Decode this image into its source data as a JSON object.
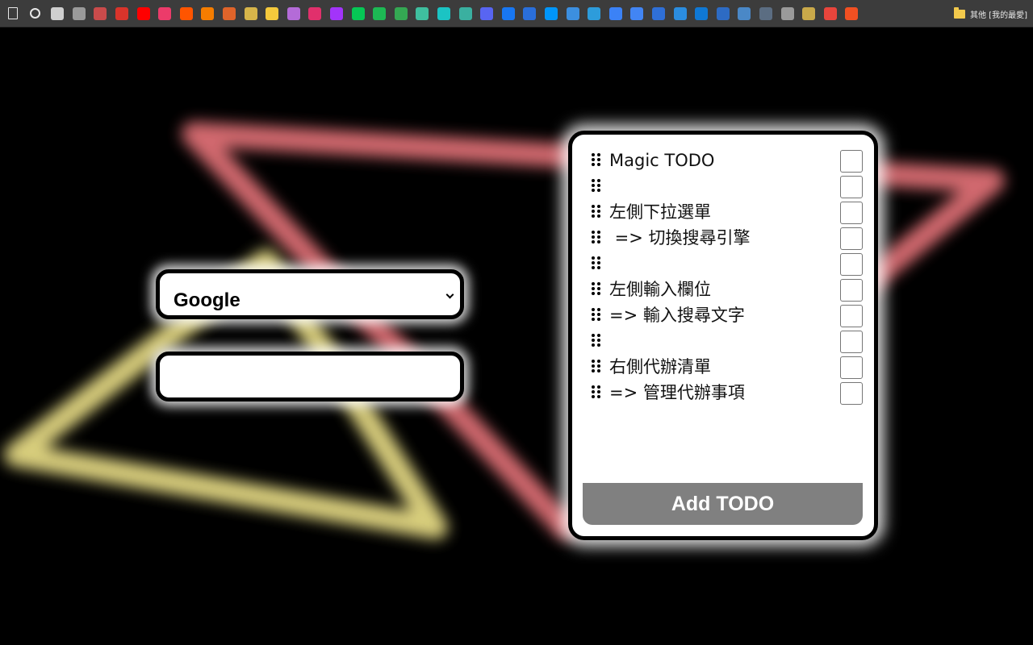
{
  "bookmarks_bar": {
    "icons": [
      {
        "name": "page-icon",
        "kind": "doc",
        "color": "#e8e8e8"
      },
      {
        "name": "search-page-icon",
        "kind": "search",
        "color": "#e8e8e8"
      },
      {
        "name": "bookmark-icon-3",
        "color": "#cfcfcf"
      },
      {
        "name": "bookmark-icon-4",
        "color": "#9a9a9a"
      },
      {
        "name": "bookmark-icon-5",
        "color": "#c94b4b"
      },
      {
        "name": "bookmark-icon-6",
        "color": "#d9342b"
      },
      {
        "name": "youtube-icon",
        "color": "#ff0000"
      },
      {
        "name": "bookmark-icon-8",
        "color": "#ec3b6a"
      },
      {
        "name": "soundcloud-icon",
        "color": "#ff5500"
      },
      {
        "name": "blogger-icon",
        "color": "#f57d00"
      },
      {
        "name": "bookmark-icon-11",
        "color": "#e0642a"
      },
      {
        "name": "bookmark-icon-12",
        "color": "#d7b54a"
      },
      {
        "name": "bookmark-icon-13",
        "color": "#f5c93c"
      },
      {
        "name": "bookmark-icon-14",
        "color": "#b46bd8"
      },
      {
        "name": "instagram-icon",
        "color": "#e1306c"
      },
      {
        "name": "messenger-icon",
        "color": "#a334fa"
      },
      {
        "name": "line-icon",
        "color": "#06c755"
      },
      {
        "name": "spotify-icon",
        "color": "#1db954"
      },
      {
        "name": "sheets-icon",
        "color": "#34a853"
      },
      {
        "name": "bookmark-icon-20",
        "color": "#3fbf9f"
      },
      {
        "name": "bookmark-icon-21",
        "color": "#1bc4c4"
      },
      {
        "name": "bookmark-icon-22",
        "color": "#3ab0a0"
      },
      {
        "name": "discord-icon",
        "color": "#5865f2"
      },
      {
        "name": "facebook-icon",
        "color": "#1877f2"
      },
      {
        "name": "bookmark-icon-25",
        "color": "#2a6fdb"
      },
      {
        "name": "pixiv-icon",
        "color": "#0096fa"
      },
      {
        "name": "bookmark-icon-27",
        "color": "#3c8fe0"
      },
      {
        "name": "edge-icon",
        "color": "#2d9cdb"
      },
      {
        "name": "bookmark-icon-29",
        "color": "#3b82f6"
      },
      {
        "name": "translate-icon",
        "color": "#4285f4"
      },
      {
        "name": "bookmark-icon-31",
        "color": "#2f6fd6"
      },
      {
        "name": "bookmark-icon-32",
        "color": "#2b8de0"
      },
      {
        "name": "onedrive-icon",
        "color": "#0f78d4"
      },
      {
        "name": "bookmark-icon-34",
        "color": "#2d6bc4"
      },
      {
        "name": "bookmark-icon-35",
        "color": "#4a88c7"
      },
      {
        "name": "bookmark-icon-36",
        "color": "#5b6d82"
      },
      {
        "name": "openai-icon",
        "color": "#9a9a9a"
      },
      {
        "name": "bookmark-icon-38",
        "color": "#c9a94a"
      },
      {
        "name": "chrome-icon",
        "color": "#e8453c"
      },
      {
        "name": "microsoft-icon",
        "color": "#f25022"
      }
    ],
    "other_bookmarks_label": "其他 [我的最愛]"
  },
  "search": {
    "engine_options": [
      "Google"
    ],
    "selected_engine": "Google",
    "input_value": "",
    "input_placeholder": ""
  },
  "todo": {
    "items": [
      {
        "text": "Magic TODO",
        "done": false
      },
      {
        "text": "",
        "done": false
      },
      {
        "text": "左側下拉選單",
        "done": false
      },
      {
        "text": " => 切換搜尋引擎",
        "done": false
      },
      {
        "text": "",
        "done": false
      },
      {
        "text": "左側輸入欄位",
        "done": false
      },
      {
        "text": "=> 輸入搜尋文字",
        "done": false
      },
      {
        "text": "",
        "done": false
      },
      {
        "text": "右側代辦清單",
        "done": false
      },
      {
        "text": "=> 管理代辦事項",
        "done": false
      }
    ],
    "add_label": "Add TODO"
  },
  "colors": {
    "background": "#000000",
    "neon_red": "#e8757a",
    "neon_yellow": "#f0e48a",
    "button_gray": "#808080"
  }
}
